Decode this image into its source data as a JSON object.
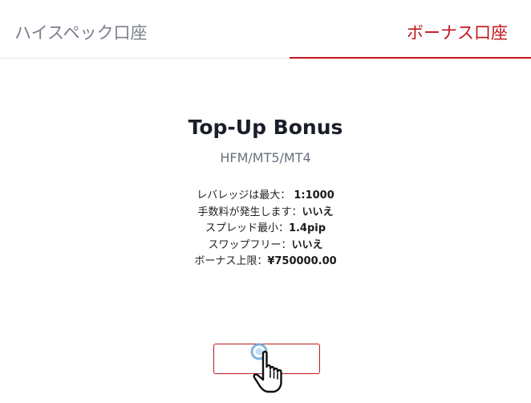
{
  "tabs": {
    "high_spec_account": "ハイスペック口座",
    "bonus_account": "ボーナス口座"
  },
  "plan": {
    "title": "Top-Up Bonus",
    "platforms": "HFM/MT5/MT4",
    "features": [
      {
        "label": "レバレッジは最大： ",
        "value": "1:1000"
      },
      {
        "label": "手数料が発生します：",
        "value": "いいえ"
      },
      {
        "label": "スプレッド最小：",
        "value": "1.4pip"
      },
      {
        "label": "スワップフリー：",
        "value": "いいえ"
      },
      {
        "label": "ボーナス上限：",
        "value": "¥750000.00"
      }
    ],
    "cta_label": ""
  },
  "colors": {
    "accent": "#c2161c",
    "inactive_tab": "#7a7f8c",
    "title": "#1a1e2a"
  },
  "icons": {
    "cursor": "hand-pointer-cursor-icon"
  }
}
